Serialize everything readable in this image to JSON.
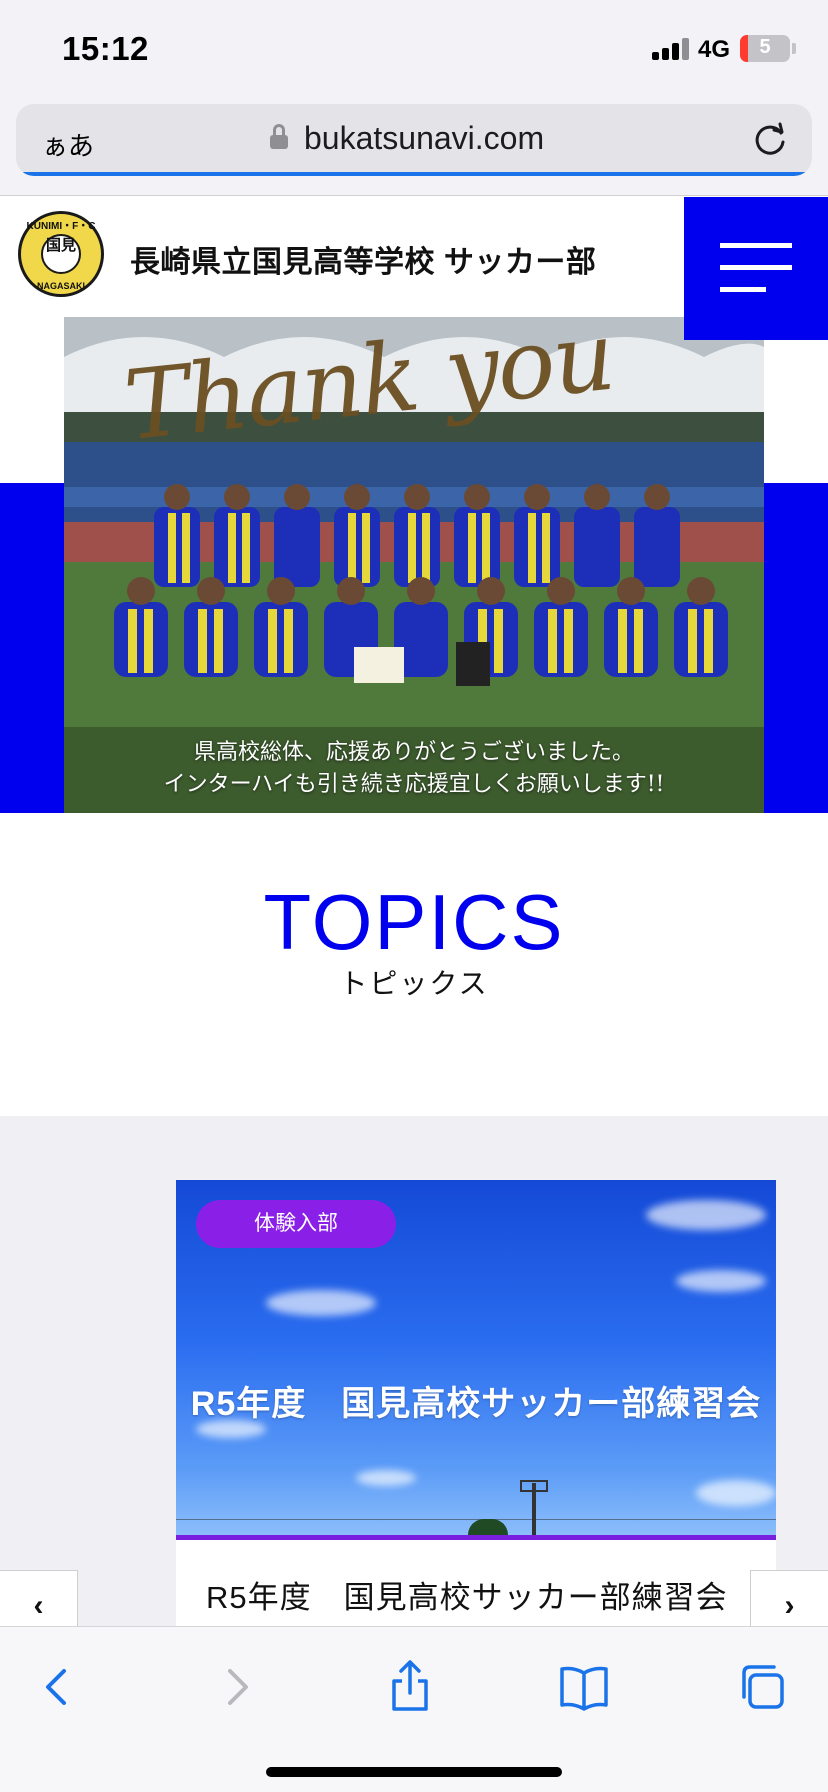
{
  "status_bar": {
    "time": "15:12",
    "network": "4G",
    "battery": "5"
  },
  "address_bar": {
    "text_size_label": "ぁあ",
    "url": "bukatsunavi.com"
  },
  "header": {
    "logo_top_text": "KUNIMI・F・C",
    "logo_center_text": "国見",
    "logo_bottom_text": "NAGASAKI",
    "site_title": "長崎県立国見高等学校 サッカー部"
  },
  "hero": {
    "script_text": "Thank you",
    "caption_line1": "県高校総体、応援ありがとうございました。",
    "caption_line2": "インターハイも引き続き応援宜しくお願いします!!"
  },
  "topics": {
    "heading_en": "TOPICS",
    "heading_ja": "トピックス",
    "cards": [
      {
        "badge": "体験入部",
        "image_title": "R5年度　国見高校サッカー部練習会",
        "title": "R5年度　国見高校サッカー部練習会"
      }
    ],
    "prev_label": "‹",
    "next_label": "›"
  },
  "colors": {
    "brand_blue": "#0000ee",
    "badge_purple": "#8a1fe8"
  },
  "toolbar": {
    "icons": [
      "back-icon",
      "forward-icon",
      "share-icon",
      "bookmarks-icon",
      "tabs-icon"
    ]
  }
}
